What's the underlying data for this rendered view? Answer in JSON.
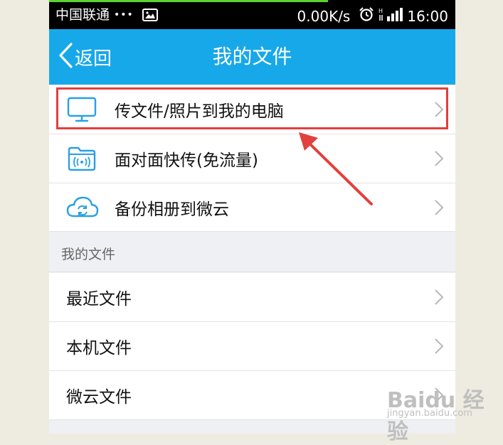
{
  "status_bar": {
    "carrier": "中国联通",
    "dots": "•••",
    "speed": "0.00K/s",
    "time": "16:00",
    "icons": [
      "image-icon",
      "alarm-icon",
      "signal-icon"
    ]
  },
  "nav": {
    "back_label": "返回",
    "title": "我的文件"
  },
  "features": [
    {
      "label": "传文件/照片到我的电脑",
      "icon": "computer-icon"
    },
    {
      "label": "面对面快传(免流量)",
      "icon": "wireless-folder-icon"
    },
    {
      "label": "备份相册到微云",
      "icon": "cloud-sync-icon"
    }
  ],
  "section": {
    "title": "我的文件"
  },
  "files": [
    {
      "label": "最近文件"
    },
    {
      "label": "本机文件"
    },
    {
      "label": "微云文件"
    }
  ],
  "watermark": {
    "main": "Baidu 经验",
    "sub": "jingyan.baidu.com"
  },
  "colors": {
    "nav_bar": "#17a8e9",
    "highlight": "#e23f3f",
    "icon_blue": "#29a0e2",
    "page_bg": "#eeebe0"
  }
}
